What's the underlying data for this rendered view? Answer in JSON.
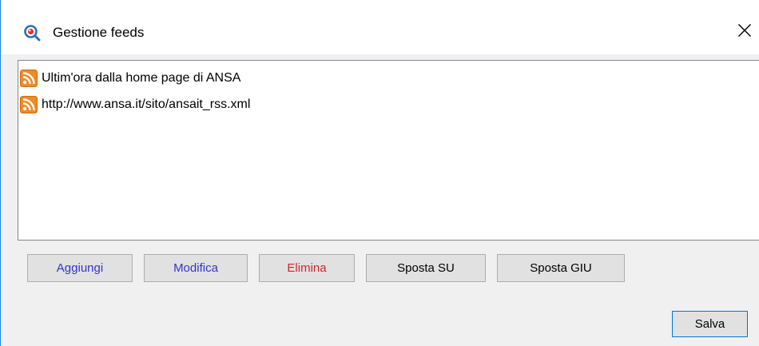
{
  "window": {
    "title": "Gestione feeds"
  },
  "feeds": [
    {
      "label": "Ultim'ora dalla home page di ANSA"
    },
    {
      "label": "http://www.ansa.it/sito/ansait_rss.xml"
    }
  ],
  "buttons": {
    "add": {
      "label": "Aggiungi",
      "color": "#3434c8"
    },
    "edit": {
      "label": "Modifica",
      "color": "#3434c8"
    },
    "delete": {
      "label": "Elimina",
      "color": "#c8282d"
    },
    "move_up": {
      "label": "Sposta SU",
      "color": "#000000"
    },
    "move_down": {
      "label": "Sposta GIU",
      "color": "#000000"
    },
    "save": {
      "label": "Salva"
    }
  },
  "icons": {
    "app": "magnifier-icon",
    "close": "close-icon",
    "feed": "rss-icon"
  },
  "colors": {
    "rss_orange": "#f08a24",
    "accent_border": "#0078d7"
  }
}
